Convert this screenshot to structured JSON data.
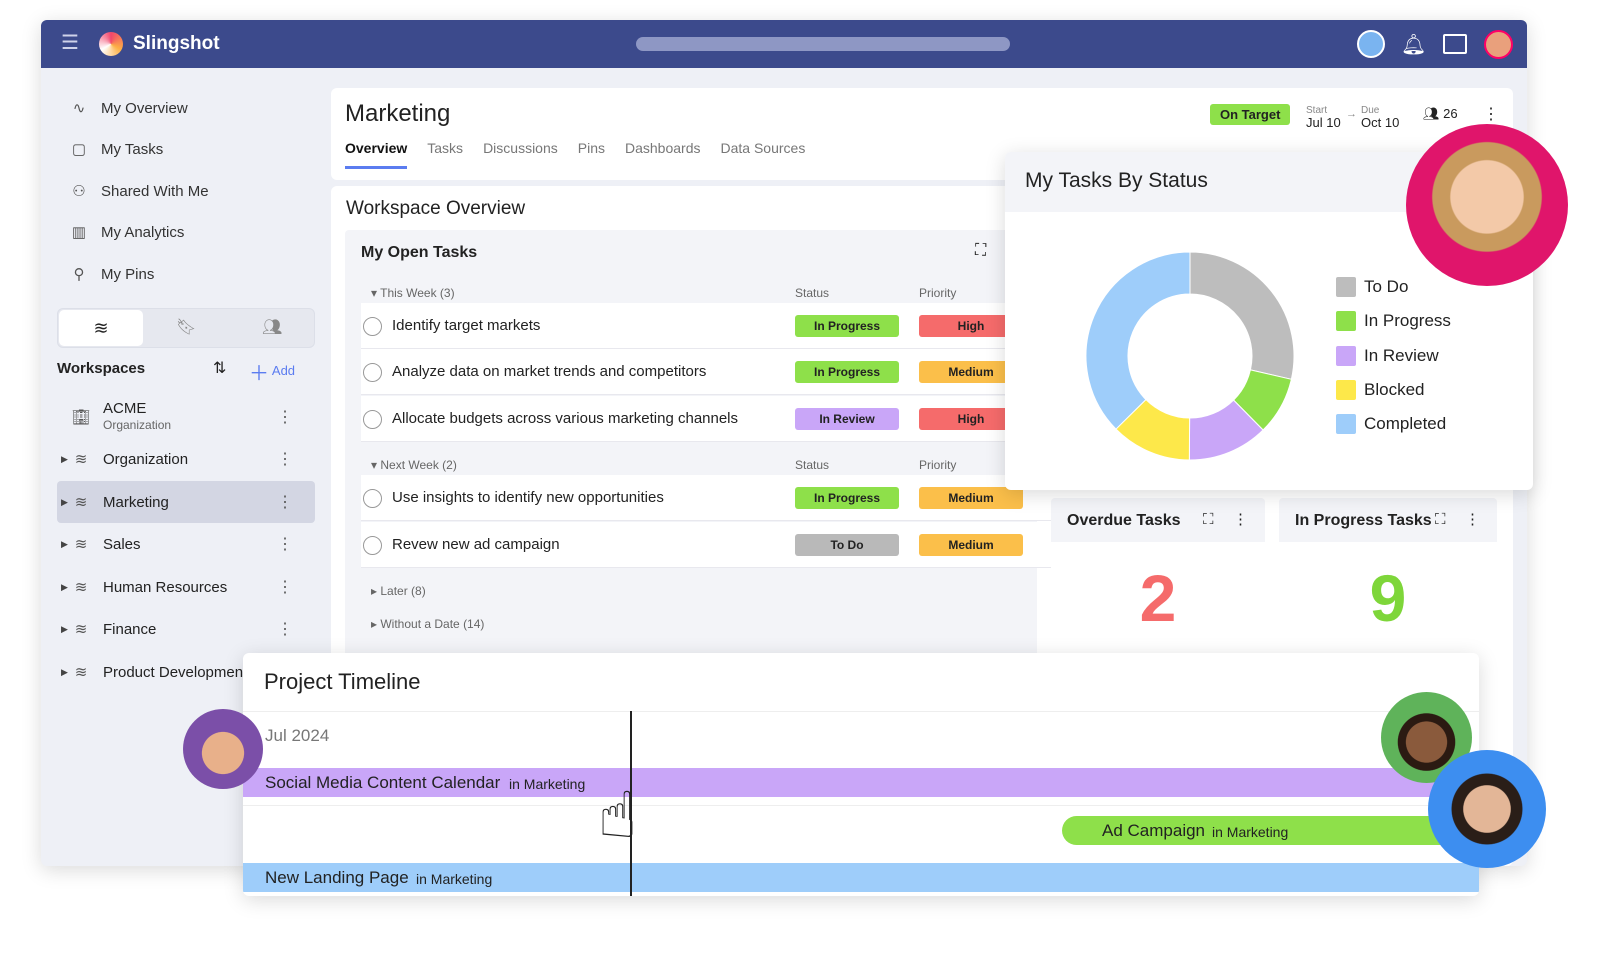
{
  "app": {
    "name": "Slingshot"
  },
  "sidebar": {
    "items": [
      {
        "label": "My Overview",
        "icon": "pulse-icon"
      },
      {
        "label": "My Tasks",
        "icon": "clipboard-icon"
      },
      {
        "label": "Shared With Me",
        "icon": "user-share-icon"
      },
      {
        "label": "My Analytics",
        "icon": "bar-chart-icon"
      },
      {
        "label": "My Pins",
        "icon": "pin-icon"
      }
    ],
    "workspaces_title": "Workspaces",
    "add_label": "Add",
    "workspaces": [
      {
        "label": "ACME",
        "sub": "Organization"
      },
      {
        "label": "Organization"
      },
      {
        "label": "Marketing",
        "selected": true
      },
      {
        "label": "Sales"
      },
      {
        "label": "Human Resources"
      },
      {
        "label": "Finance"
      },
      {
        "label": "Product Development"
      }
    ]
  },
  "workspace": {
    "title": "Marketing",
    "status": "On Target",
    "start_label": "Start",
    "start": "Jul 10",
    "due_label": "Due",
    "due": "Oct 10",
    "members": "26",
    "tabs": [
      "Overview",
      "Tasks",
      "Discussions",
      "Pins",
      "Dashboards",
      "Data Sources"
    ],
    "active_tab": "Overview"
  },
  "overview": {
    "title": "Workspace Overview",
    "open_tasks": {
      "title": "My Open Tasks",
      "status_header": "Status",
      "priority_header": "Priority",
      "groups": [
        {
          "label": "This Week (3)",
          "tasks": [
            {
              "name": "Identify target markets",
              "status": "In Progress",
              "priority": "High"
            },
            {
              "name": "Analyze data on market trends and competitors",
              "status": "In Progress",
              "priority": "Medium"
            },
            {
              "name": "Allocate budgets across various marketing channels",
              "status": "In Review",
              "priority": "High"
            }
          ]
        },
        {
          "label": "Next Week (2)",
          "tasks": [
            {
              "name": "Use insights to identify new opportunities",
              "status": "In Progress",
              "priority": "Medium"
            },
            {
              "name": "Revew new ad campaign",
              "status": "To Do",
              "priority": "Medium"
            }
          ]
        }
      ],
      "later": "Later (8)",
      "without_date": "Without a Date (14)"
    },
    "overdue": {
      "title": "Overdue Tasks",
      "value": "2"
    },
    "in_progress": {
      "title": "In Progress Tasks",
      "value": "9"
    }
  },
  "colors": {
    "In Progress": "#8ee04a",
    "In Review": "#c9a6f8",
    "To Do": "#b9b9b9",
    "High": "#f56b6b",
    "Medium": "#fbbf4a",
    "Blocked": "#fde84a",
    "Completed": "#9ecdfa",
    "header": "#3c4a8c"
  },
  "chart_data": {
    "type": "pie",
    "title": "My Tasks By Status",
    "donut": true,
    "categories": [
      "To Do",
      "In Progress",
      "In Review",
      "Blocked",
      "Completed"
    ],
    "values": [
      28.6,
      9,
      12.5,
      12.5,
      37.4
    ],
    "unit": "percent (estimated)",
    "colors": [
      "#bdbdbd",
      "#8ee04a",
      "#c9a6f8",
      "#fde84a",
      "#9ecdfa"
    ],
    "legend": "right"
  },
  "timeline": {
    "title": "Project Timeline",
    "month": "Jul 2024",
    "bars": [
      {
        "name": "Social Media Content Calendar",
        "ws": "in Marketing",
        "color": "#c9a6f8"
      },
      {
        "name": "Ad Campaign",
        "ws": "in Marketing",
        "color": "#8ee04a"
      },
      {
        "name": "New Landing Page",
        "ws": "in Marketing",
        "color": "#9ecdfa"
      }
    ]
  }
}
